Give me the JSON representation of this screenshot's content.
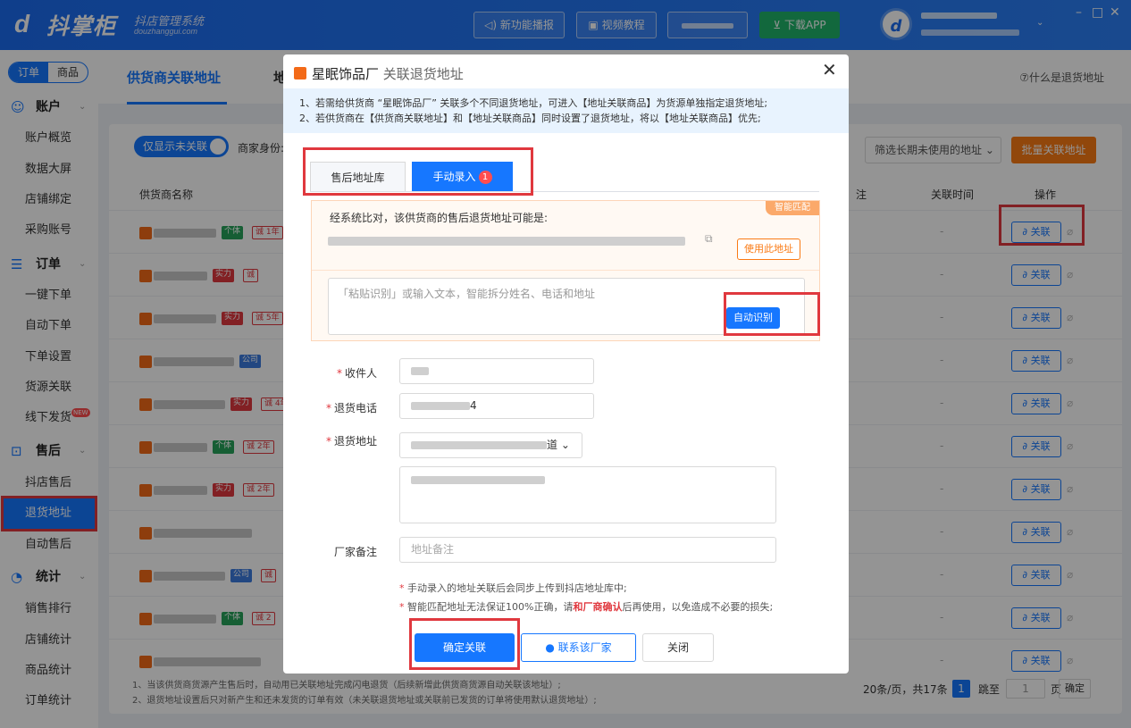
{
  "app": {
    "brand": "抖掌柜",
    "brand_sub": "抖店管理系统",
    "brand_domain": "douzhanggui.com",
    "toolbar": {
      "news": "新功能播报",
      "video": "视频教程",
      "download": "下载APP"
    },
    "window": {
      "min": "–",
      "max": "□",
      "close": "✕"
    }
  },
  "sidebar": {
    "seg": [
      "订单",
      "商品"
    ],
    "groups": [
      {
        "label": "账户",
        "items": [
          "账户概览",
          "数据大屏",
          "店铺绑定",
          "采购账号"
        ]
      },
      {
        "label": "订单",
        "items": [
          "一键下单",
          "自动下单",
          "下单设置",
          "货源关联",
          "线下发货"
        ]
      },
      {
        "label": "售后",
        "items": [
          "抖店售后",
          "退货地址",
          "自动售后"
        ]
      },
      {
        "label": "统计",
        "items": [
          "销售排行",
          "店铺统计",
          "商品统计",
          "订单统计"
        ]
      }
    ],
    "new_badge": "NEW",
    "active": "退货地址"
  },
  "page": {
    "tab_active": "供货商关联地址",
    "tab2": "地",
    "help": "什么是退货地址",
    "toggle": "仅显示未关联",
    "merchant_label": "商家身份:",
    "filter": "筛选长期未使用的地址",
    "batch": "批量关联地址",
    "columns": {
      "name": "供货商名称",
      "note": "注",
      "time": "关联时间",
      "op": "操作"
    },
    "rows": [
      {
        "tags": [
          [
            "ind",
            "个体"
          ],
          [
            "yr",
            "诚 1年"
          ]
        ],
        "time": "-"
      },
      {
        "tags": [
          [
            "str",
            "实力"
          ],
          [
            "yr",
            "诚"
          ]
        ],
        "time": "-"
      },
      {
        "tags": [
          [
            "str",
            "实力"
          ],
          [
            "yr",
            "诚 5年"
          ]
        ],
        "time": "-"
      },
      {
        "tags": [
          [
            "com",
            "公司"
          ]
        ],
        "time": "-"
      },
      {
        "tags": [
          [
            "str",
            "实力"
          ],
          [
            "yr",
            "诚 4年"
          ]
        ],
        "time": "-"
      },
      {
        "tags": [
          [
            "ind",
            "个体"
          ],
          [
            "yr",
            "诚 2年"
          ]
        ],
        "time": "-"
      },
      {
        "tags": [
          [
            "str",
            "实力"
          ],
          [
            "yr",
            "诚 2年"
          ]
        ],
        "time": "-"
      },
      {
        "tags": [],
        "time": "-"
      },
      {
        "tags": [
          [
            "com",
            "公司"
          ],
          [
            "yr",
            "诚"
          ]
        ],
        "time": "-"
      },
      {
        "tags": [
          [
            "ind",
            "个体"
          ],
          [
            "yr",
            "诚 2"
          ]
        ],
        "time": "-"
      },
      {
        "tags": [],
        "time": "-"
      }
    ],
    "link_label": "关联",
    "footer": [
      "1、当该供货商货源产生售后时，自动用已关联地址完成闪电退货（后续新增此供货商货源自动关联该地址）;",
      "2、退货地址设置后只对新产生和还未发货的订单有效（未关联退货地址或关联前已发货的订单将使用默认退货地址）;"
    ],
    "pager": {
      "per_page": "20条/页，共17条",
      "page": "1",
      "jump": "跳至",
      "jump_value": "1",
      "page_unit": "页",
      "confirm": "确定"
    }
  },
  "modal": {
    "supplier": "星眠饰品厂",
    "title": "关联退货地址",
    "notice": [
      "1、若需给供货商 “星眠饰品厂” 关联多个不同退货地址，可进入【地址关联商品】为货源单独指定退货地址;",
      "2、若供货商在【供货商关联地址】和【地址关联商品】同时设置了退货地址，将以【地址关联商品】优先;"
    ],
    "tabs": [
      "售后地址库",
      "手动录入"
    ],
    "tab_count": "1",
    "smart_tag": "智能匹配",
    "smart_text": "经系统比对，该供货商的售后退货地址可能是:",
    "use_addr": "使用此地址",
    "paste_placeholder": "「粘贴识别」或输入文本，智能拆分姓名、电话和地址",
    "auto_recognize": "自动识别",
    "fields": {
      "receiver": "收件人",
      "phone": "退货电话",
      "phone_suffix": "4",
      "address": "退货地址",
      "street_suffix": "道",
      "remark": "厂家备注",
      "remark_placeholder": "地址备注"
    },
    "notes": {
      "n1": "手动录入的地址关联后会同步上传到抖店地址库中;",
      "n2_a": "智能匹配地址无法保证100%正确，请",
      "n2_b": "和厂商确认",
      "n2_c": "后再使用，以免造成不必要的损失;"
    },
    "buttons": {
      "confirm": "确定关联",
      "contact": "联系该厂家",
      "close": "关闭"
    }
  }
}
